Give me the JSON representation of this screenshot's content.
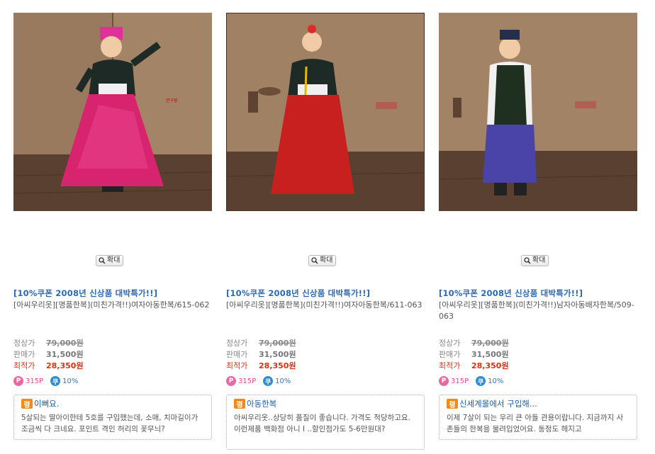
{
  "zoom_label": "확대",
  "labels": {
    "regular": "정상가",
    "sale": "판매가",
    "best": "최적가"
  },
  "products": [
    {
      "event": "[10%쿠폰 2008년 신상품 대박특가!!]",
      "name": "[아씨우리옷][명품한복](미친가격!!)여자아동한복/615-062",
      "regular_price": "79,000원",
      "sale_price": "31,500원",
      "best_price": "28,350원",
      "points": "315P",
      "coupon": "10%",
      "review_tag": "평",
      "review_title": "이뻐요.",
      "review_text": "5살되는 딸아이한테 5호를 구입했는데, 소매, 치마길이가 조금씩 다 크네요. 포인트 격인 허리의 꽃무늬?"
    },
    {
      "event": "[10%쿠폰 2008년 신상품 대박특가!!]",
      "name": "[아씨우리옷][명품한복](미친가격!!)여자아동한복/611-063",
      "regular_price": "79,000원",
      "sale_price": "31,500원",
      "best_price": "28,350원",
      "points": "315P",
      "coupon": "10%",
      "review_tag": "평",
      "review_title": "아동한복",
      "review_text": "아씨우리옷..상당히 품질이 좋습니다. 가격도 적당하고요.이런제품 백화점 아니 I ..할인점가도 5-6만원대?"
    },
    {
      "event": "[10%쿠폰 2008년 신상품 대박특가!!]",
      "name": "[아씨우리옷][명품한복](미친가격!!)남자아동배자한복/509-063",
      "regular_price": "79,000원",
      "sale_price": "31,500원",
      "best_price": "28,350원",
      "points": "315P",
      "coupon": "10%",
      "review_tag": "평",
      "review_title": "신세계몰에서 구입해...",
      "review_text": "이제 7살이 되는 우리 큰 아들 관용이랍니다. 지금까지 사촌들의 한복을 물려입었어요. 동정도 헤지고"
    }
  ],
  "colors": {
    "event": "#2a6ab0",
    "best_price": "#e03010",
    "review_title": "#1b5fa8",
    "tag": "#f08a1c"
  }
}
